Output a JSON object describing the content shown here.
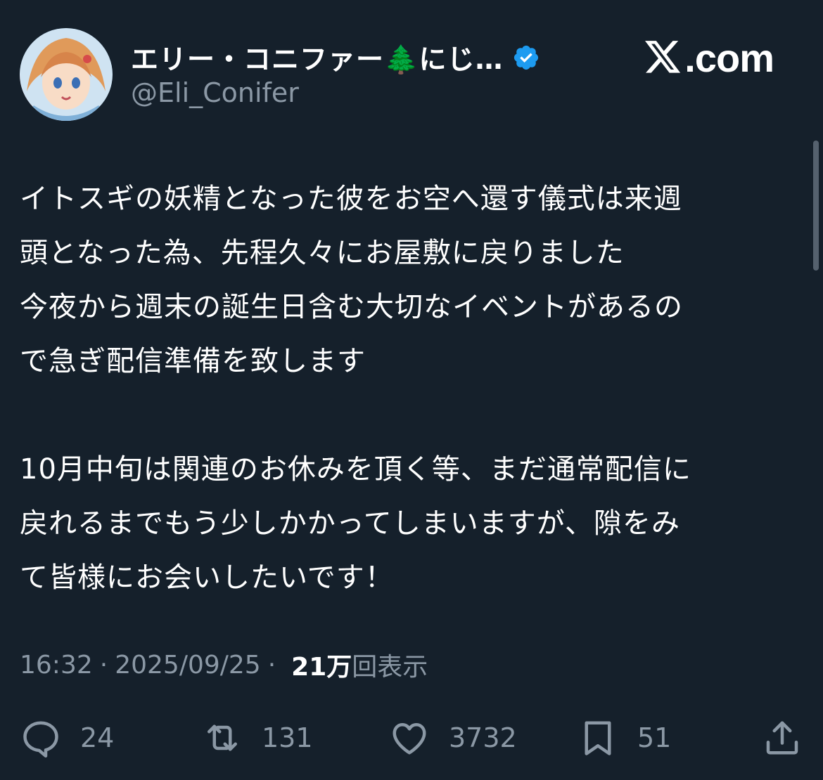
{
  "author": {
    "display_name": "エリー・コニファー🌲にじ…",
    "handle": "@Eli_Conifer",
    "verified": true,
    "verified_color": "#1d9bf0"
  },
  "site": {
    "logo_text": ".com"
  },
  "tweet": {
    "paragraphs": [
      "イトスギの妖精となった彼をお空へ還す儀式は来週\n頭となった為、先程久々にお屋敷に戻りました\n今夜から週末の誕生日含む大切なイベントがあるの\nで急ぎ配信準備を致します",
      "10月中旬は関連のお休みを頂く等、まだ通常配信に\n戻れるまでもう少しかかってしまいますが、隙をみ\nて皆様にお会いしたいです！"
    ],
    "time": "16:32",
    "date": "2025/09/25",
    "views_count": "21万",
    "views_label": "回表示"
  },
  "actions": {
    "reply_count": "24",
    "retweet_count": "131",
    "like_count": "3732",
    "bookmark_count": "51"
  },
  "colors": {
    "background": "#15202b",
    "text": "#ffffff",
    "muted": "#8b98a5"
  }
}
